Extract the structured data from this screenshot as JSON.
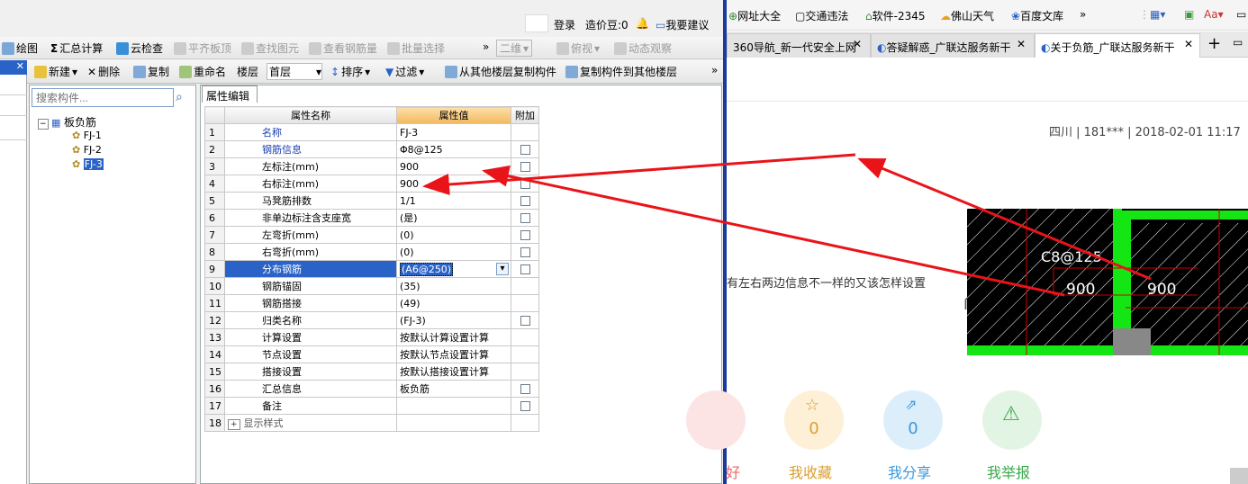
{
  "top": {
    "login": "登录",
    "cost_beans": "造价豆:0",
    "suggest": "我要建议"
  },
  "toolbar1": {
    "draw": "绘图",
    "sum": "汇总计算",
    "check": "云检查",
    "align": "平齐板顶",
    "find": "查找图元",
    "view_rebar": "查看钢筋量",
    "batch": "批量选择",
    "view2d": "二维",
    "top_view": "俯视",
    "dynamic": "动态观察"
  },
  "toolbar2": {
    "new": "新建",
    "delete": "删除",
    "copy": "复制",
    "rename": "重命名",
    "floor_label": "楼层",
    "floor_value": "首层",
    "sort": "排序",
    "filter": "过滤",
    "copy_from": "从其他楼层复制构件",
    "copy_to": "复制构件到其他楼层"
  },
  "tree": {
    "search_placeholder": "搜索构件...",
    "root": "板负筋",
    "items": [
      "FJ-1",
      "FJ-2",
      "FJ-3"
    ]
  },
  "props": {
    "tab": "属性编辑",
    "col_name": "属性名称",
    "col_value": "属性值",
    "col_extra": "附加",
    "rows": [
      {
        "num": "1",
        "name": "名称",
        "value": "FJ-3"
      },
      {
        "num": "2",
        "name": "钢筋信息",
        "value": "Φ8@125"
      },
      {
        "num": "3",
        "name": "左标注(mm)",
        "value": "900"
      },
      {
        "num": "4",
        "name": "右标注(mm)",
        "value": "900"
      },
      {
        "num": "5",
        "name": "马凳筋排数",
        "value": "1/1"
      },
      {
        "num": "6",
        "name": "非单边标注含支座宽",
        "value": "(是)"
      },
      {
        "num": "7",
        "name": "左弯折(mm)",
        "value": "(0)"
      },
      {
        "num": "8",
        "name": "右弯折(mm)",
        "value": "(0)"
      },
      {
        "num": "9",
        "name": "分布钢筋",
        "value": "(A6@250)"
      },
      {
        "num": "10",
        "name": "钢筋锚固",
        "value": "(35)"
      },
      {
        "num": "11",
        "name": "钢筋搭接",
        "value": "(49)"
      },
      {
        "num": "12",
        "name": "归类名称",
        "value": "(FJ-3)"
      },
      {
        "num": "13",
        "name": "计算设置",
        "value": "按默认计算设置计算"
      },
      {
        "num": "14",
        "name": "节点设置",
        "value": "按默认节点设置计算"
      },
      {
        "num": "15",
        "name": "搭接设置",
        "value": "按默认搭接设置计算"
      },
      {
        "num": "16",
        "name": "汇总信息",
        "value": "板负筋"
      },
      {
        "num": "17",
        "name": "备注",
        "value": ""
      },
      {
        "num": "18",
        "name": "显示样式",
        "value": ""
      }
    ]
  },
  "browser": {
    "bookmarks": [
      "网址大全",
      "交通违法",
      "软件-2345",
      "佛山天气",
      "百度文库"
    ],
    "tabs": [
      "360导航_新一代安全上网",
      "答疑解惑_广联达服务新干",
      "关于负筋_广联达服务新干"
    ],
    "meta": "四川 | 181*** | 2018-02-01 11:17",
    "question": "有左右两边信息不一样的又该怎样设置",
    "cad": {
      "rebar": "C8@125",
      "left": "900",
      "right": "900"
    },
    "actions": [
      {
        "count": "0",
        "label": "我收藏"
      },
      {
        "count": "0",
        "label": "我分享"
      },
      {
        "count": "",
        "label": "我举报"
      }
    ],
    "partial_label": "好"
  },
  "colors": {
    "accent": "#2a63c7",
    "arrow": "#e8141a",
    "cad_green": "#14e614"
  }
}
